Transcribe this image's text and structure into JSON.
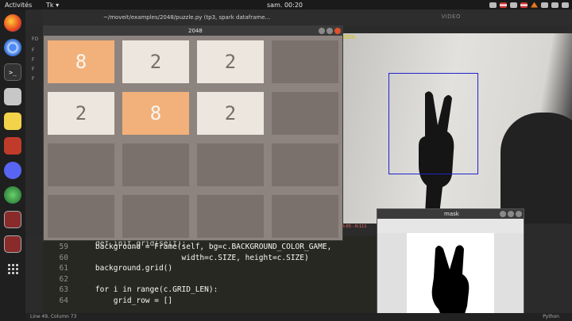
{
  "topbar": {
    "activities": "Activités",
    "app_menu": "Tk ▾",
    "clock": "sam. 00:20"
  },
  "editor": {
    "title": "~/moveit/examples/2048/puzzle.py (tp3, spark dataframe...",
    "video_label": "VIDEO"
  },
  "filetree": {
    "labels": [
      "FO",
      "F",
      "F",
      "F",
      "F"
    ]
  },
  "game": {
    "title": "2048",
    "grid": [
      [
        "8",
        "2",
        "2",
        ""
      ],
      [
        "2",
        "8",
        "2",
        ""
      ],
      [
        "",
        "",
        "",
        ""
      ],
      [
        "",
        "",
        "",
        ""
      ]
    ]
  },
  "mask_window": {
    "title": "mask"
  },
  "video_overlay": {
    "header_text": "00%",
    "status_text": "t:65 - R:111"
  },
  "code": {
    "partial_top": "def init_grid(self):",
    "lines": [
      {
        "num": "59",
        "text": "    background = Frame(self, bg=c.BACKGROUND_COLOR_GAME,"
      },
      {
        "num": "60",
        "text": "                       width=c.SIZE, height=c.SIZE)"
      },
      {
        "num": "61",
        "text": "    background.grid()"
      },
      {
        "num": "62",
        "text": ""
      },
      {
        "num": "63",
        "text": "    for i in range(c.GRID_LEN):"
      },
      {
        "num": "64",
        "text": "        grid_row = []"
      }
    ]
  },
  "statusbar": {
    "position": "Line 49, Column 73",
    "language": "Python"
  },
  "colors": {
    "tile_2": "#ede6de",
    "tile_8": "#f2b17a",
    "tile_empty": "#7b716c",
    "bbox": "#2222cc"
  }
}
